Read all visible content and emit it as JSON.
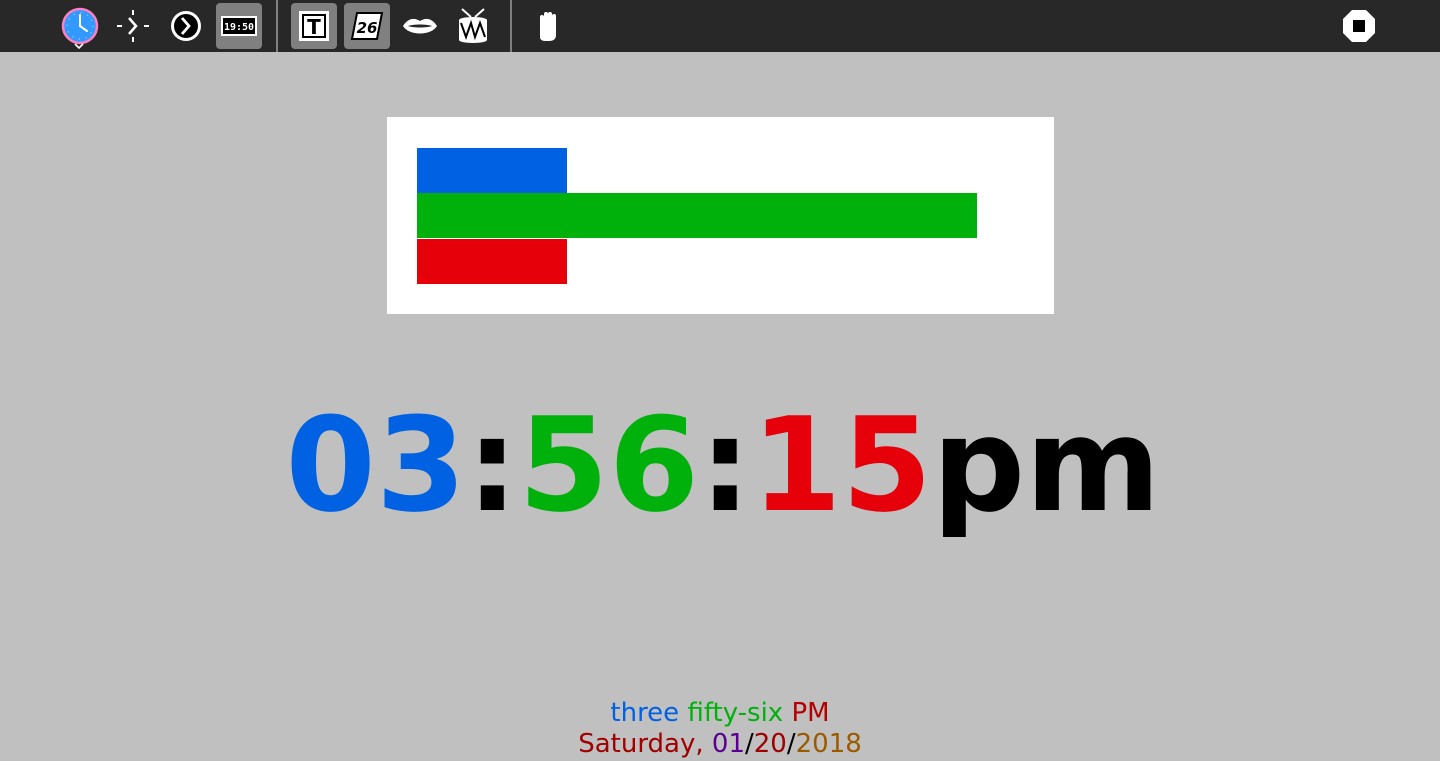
{
  "toolbar": {
    "buttons": [
      {
        "name": "clock-activity-icon",
        "active": false
      },
      {
        "name": "simple-clock-mode-icon",
        "active": false
      },
      {
        "name": "nice-clock-mode-icon",
        "active": false
      },
      {
        "name": "digital-clock-mode-icon",
        "active": true,
        "text": "19:50"
      },
      {
        "name": "write-time-icon",
        "active": true,
        "text": "T"
      },
      {
        "name": "write-date-icon",
        "active": true,
        "text": "26"
      },
      {
        "name": "speak-time-icon",
        "active": false
      },
      {
        "name": "alarm-drum-icon",
        "active": false
      },
      {
        "name": "grab-hand-icon",
        "active": false
      },
      {
        "name": "stop-icon",
        "active": false
      }
    ]
  },
  "bars": {
    "hours": {
      "value": 3,
      "max": 12,
      "color": "#0062e3"
    },
    "minutes": {
      "value": 56,
      "max": 60,
      "color": "#00b10c"
    },
    "seconds": {
      "value": 15,
      "max": 60,
      "color": "#e5000a"
    }
  },
  "time": {
    "hours": "03",
    "sep1": ":",
    "minutes": "56",
    "sep2": ":",
    "seconds": "15",
    "ampm": "pm",
    "colors": {
      "hours": "#0062e3",
      "minutes": "#00b10c",
      "seconds": "#e5000a",
      "sep": "#000000",
      "ampm": "#000000"
    }
  },
  "words": {
    "hour": "three",
    "minute": "fifty-six",
    "ampm": "PM",
    "colors": {
      "hour": "#0062e3",
      "minute": "#00b10c",
      "ampm": "#b30000"
    }
  },
  "date": {
    "weekday": "Saturday",
    "comma": ",",
    "month": "01",
    "slash1": "/",
    "day": "20",
    "slash2": "/",
    "year": "2018",
    "colors": {
      "weekday": "#a00000",
      "month": "#5a0091",
      "day": "#a00000",
      "year": "#9b5a00",
      "sep": "#000000"
    }
  }
}
